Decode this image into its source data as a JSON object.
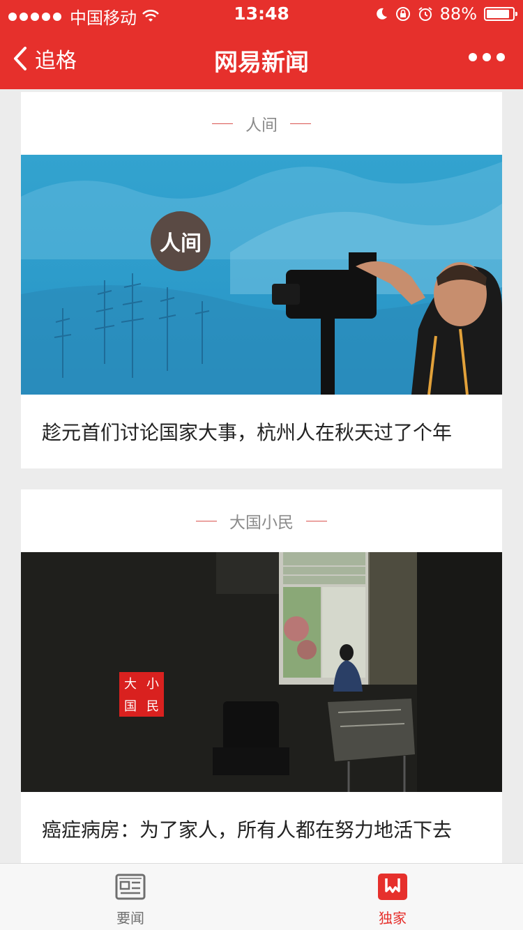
{
  "status_bar": {
    "carrier": "中国移动",
    "time": "13:48",
    "battery": "88%",
    "battery_level": 0.88
  },
  "nav": {
    "back_label": "追格",
    "title": "网易新闻"
  },
  "cards": [
    {
      "section": "人间",
      "image_logo": "人间",
      "headline": "趁元首们讨论国家大事，杭州人在秋天过了个年"
    },
    {
      "section": "大国小民",
      "image_logo": [
        "小",
        "大",
        "民",
        "国"
      ],
      "headline": "癌症病房：为了家人，所有人都在努力地活下去"
    }
  ],
  "tabbar": {
    "items": [
      {
        "label": "要闻",
        "icon": "newspaper-icon",
        "active": false
      },
      {
        "label": "独家",
        "icon": "bookmark-w-icon",
        "active": true
      }
    ]
  },
  "colors": {
    "brand_red": "#e6302c",
    "background": "#ececec",
    "tab_inactive": "#6f6f6f"
  }
}
